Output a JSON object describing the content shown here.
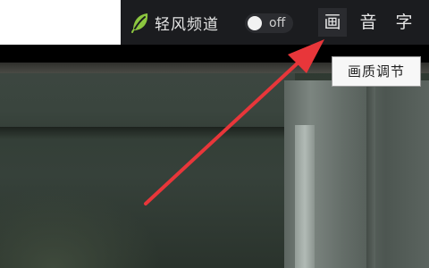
{
  "toolbar": {
    "light_mode_label": "轻风频道",
    "toggle_text": "off",
    "buttons": {
      "picture": "画",
      "audio": "音",
      "subtitle": "字"
    }
  },
  "tooltip": {
    "text": "画质调节"
  },
  "icons": {
    "light_mode": "leaf-icon"
  },
  "colors": {
    "toolbar_bg": "#1b1c1f",
    "leaf_green": "#8cc63f",
    "arrow_red": "#e8363a",
    "tooltip_bg": "#f7f7f7"
  },
  "state": {
    "light_mode_enabled": false,
    "hovered_button": "picture"
  }
}
